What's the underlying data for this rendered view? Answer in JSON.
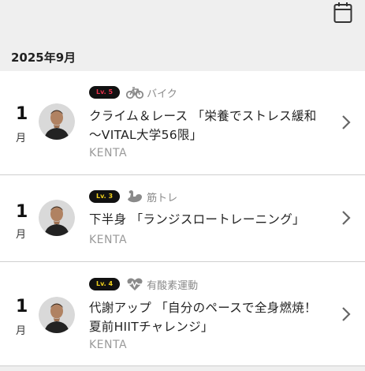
{
  "header": {
    "calendar_icon": "calendar-icon",
    "month": "2025年9月"
  },
  "colors": {
    "lv5": "#e8304b",
    "lv3": "#f2d21c",
    "lv4": "#f2d21c",
    "background": "#efefef",
    "card": "#ffffff",
    "category_gray": "#8a8a8a"
  },
  "lessons": [
    {
      "day": "1",
      "weekday": "月",
      "level": "Lv. 5",
      "category_icon": "bike-icon",
      "category": "バイク",
      "title_line1": "クライム＆レース 「栄養でストレス緩和",
      "title_line2": "～VITAL大学56限」",
      "instructor": "KENTA"
    },
    {
      "day": "1",
      "weekday": "月",
      "level": "Lv. 3",
      "category_icon": "muscle-arm-icon",
      "category": "筋トレ",
      "title_line1": "下半身 「ランジスロートレーニング」",
      "title_line2": "",
      "instructor": "KENTA"
    },
    {
      "day": "1",
      "weekday": "月",
      "level": "Lv. 4",
      "category_icon": "heart-pulse-icon",
      "category": "有酸素運動",
      "title_line1": "代謝アップ 「自分のペースで全身燃焼！",
      "title_line2": "夏前HIITチャレンジ」",
      "instructor": "KENTA"
    }
  ]
}
